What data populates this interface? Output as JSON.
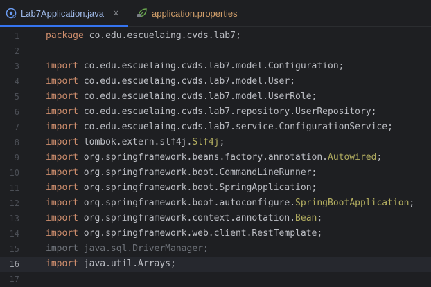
{
  "tabs": [
    {
      "label": "Lab7Application.java",
      "icon": "java-class-icon",
      "active": true,
      "close_glyph": "×"
    },
    {
      "label": "application.properties",
      "icon": "spring-leaf-icon",
      "active": false
    }
  ],
  "editor": {
    "current_line": 16,
    "lines": [
      {
        "n": "1",
        "kw": "package",
        "text": " co.edu.escuelaing.cvds.lab7;",
        "ann": "",
        "end": ""
      },
      {
        "n": "2",
        "kw": "",
        "text": "",
        "ann": "",
        "end": ""
      },
      {
        "n": "3",
        "kw": "import",
        "text": " co.edu.escuelaing.cvds.lab7.model.Configuration;",
        "ann": "",
        "end": ""
      },
      {
        "n": "4",
        "kw": "import",
        "text": " co.edu.escuelaing.cvds.lab7.model.User;",
        "ann": "",
        "end": ""
      },
      {
        "n": "5",
        "kw": "import",
        "text": " co.edu.escuelaing.cvds.lab7.model.UserRole;",
        "ann": "",
        "end": ""
      },
      {
        "n": "6",
        "kw": "import",
        "text": " co.edu.escuelaing.cvds.lab7.repository.UserRepository;",
        "ann": "",
        "end": ""
      },
      {
        "n": "7",
        "kw": "import",
        "text": " co.edu.escuelaing.cvds.lab7.service.ConfigurationService;",
        "ann": "",
        "end": ""
      },
      {
        "n": "8",
        "kw": "import",
        "text": " lombok.extern.slf4j.",
        "ann": "Slf4j",
        "end": ";"
      },
      {
        "n": "9",
        "kw": "import",
        "text": " org.springframework.beans.factory.annotation.",
        "ann": "Autowired",
        "end": ";"
      },
      {
        "n": "10",
        "kw": "import",
        "text": " org.springframework.boot.CommandLineRunner;",
        "ann": "",
        "end": ""
      },
      {
        "n": "11",
        "kw": "import",
        "text": " org.springframework.boot.SpringApplication;",
        "ann": "",
        "end": ""
      },
      {
        "n": "12",
        "kw": "import",
        "text": " org.springframework.boot.autoconfigure.",
        "ann": "SpringBootApplication",
        "end": ";"
      },
      {
        "n": "13",
        "kw": "import",
        "text": " org.springframework.context.annotation.",
        "ann": "Bean",
        "end": ";"
      },
      {
        "n": "14",
        "kw": "import",
        "text": " org.springframework.web.client.RestTemplate;",
        "ann": "",
        "end": ""
      },
      {
        "n": "15",
        "kw": "import",
        "text": " java.sql.DriverManager;",
        "ann": "",
        "end": "",
        "dim": true
      },
      {
        "n": "16",
        "kw": "import",
        "text": " java.util.Arrays;",
        "ann": "",
        "end": ""
      },
      {
        "n": "17",
        "kw": "",
        "text": "",
        "ann": "",
        "end": ""
      }
    ]
  },
  "colors": {
    "background": "#1e1f22",
    "keyword": "#cf8e6d",
    "annotation": "#b3ae60",
    "text": "#bcbec4",
    "tab_accent": "#3574f0"
  }
}
